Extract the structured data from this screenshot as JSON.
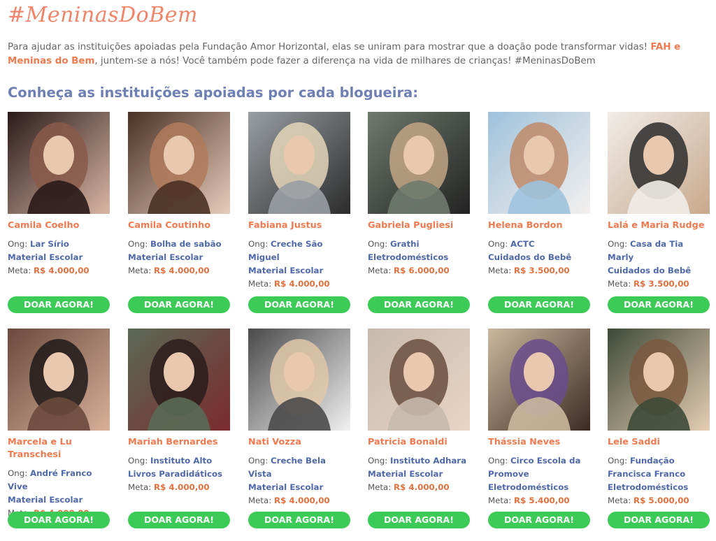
{
  "header": {
    "hashtag": "#MeninasDoBem",
    "intro_text": "Para ajudar as instituições apoiadas pela Fundação Amor Horizontal, elas se uniram para mostrar que a doação pode transformar vidas!",
    "intro_highlight": "FAH e Meninas do Bem",
    "intro_tail": ", juntem-se a nós! Você também pode fazer a diferença na vida de milhares de crianças! #MeninasDoBem",
    "section_title": "Conheça as instituições apoiadas por cada blogueira:"
  },
  "labels": {
    "ong": "Ong:",
    "meta": "Meta:",
    "button": "DOAR AGORA!"
  },
  "cards": [
    {
      "name": "Camila Coelho",
      "ong": "Lar Sírio",
      "category": "Material Escolar",
      "meta": "R$ 4.000,00",
      "colors": [
        "#2a1a1a",
        "#8a5a4a",
        "#d9b6a3"
      ]
    },
    {
      "name": "Camila Coutinho",
      "ong": "Bolha de sabão",
      "category": "Material Escolar",
      "meta": "R$ 4.000,00",
      "colors": [
        "#4a3024",
        "#b07a5c",
        "#e8cdbb"
      ]
    },
    {
      "name": "Fabiana Justus",
      "ong": "Creche São Miguel",
      "category": "Material Escolar",
      "meta": "R$ 4.000,00",
      "colors": [
        "#9a9fa3",
        "#e3d6b8",
        "#2b2b2b"
      ]
    },
    {
      "name": "Gabriela Pugliesi",
      "ong": "Grathi",
      "category": "Eletrodomésticos",
      "meta": "R$ 6.000,00",
      "colors": [
        "#6f7a6e",
        "#c2a585",
        "#222222"
      ]
    },
    {
      "name": "Helena Bordon",
      "ong": "ACTC",
      "category": "Cuidados do Bebê",
      "meta": "R$ 3.500,00",
      "colors": [
        "#9fc2dc",
        "#c08a68",
        "#f4f0ee"
      ]
    },
    {
      "name": "Lalá e Maria Rudge",
      "ong": "Casa da Tia Marly",
      "category": "Cuidados do Bebê",
      "meta": "R$ 3.500,00",
      "colors": [
        "#f0ece8",
        "#2b2b2b",
        "#c9a98c"
      ]
    },
    {
      "name": "Marcela e Lu Transchesi",
      "ong": "André Franco Vive",
      "category": "Material Escolar",
      "meta": "R$ 4.000,00",
      "colors": [
        "#6a4a3c",
        "#1f1a1a",
        "#d8b09a"
      ]
    },
    {
      "name": "Mariah Bernardes",
      "ong": "Instituto Alto Livros Paradidáticos",
      "category": "",
      "meta": "R$ 4.000,00",
      "colors": [
        "#5a6a54",
        "#2a1c1c",
        "#7b2a2e"
      ]
    },
    {
      "name": "Nati Vozza",
      "ong": "Creche Bela Vista",
      "category": "Material Escolar",
      "meta": "R$ 4.000,00",
      "colors": [
        "#4a4a4a",
        "#e0c8a8",
        "#f1f1f1"
      ]
    },
    {
      "name": "Patricia Bonaldi",
      "ong": "Instituto Adhara",
      "category": "Material Escolar",
      "meta": "R$ 4.000,00",
      "colors": [
        "#c7b9ac",
        "#6a4e3e",
        "#e9d5c6"
      ]
    },
    {
      "name": "Thássia Neves",
      "ong": "Circo Escola da Promove",
      "category": "Eletrodomésticos",
      "meta": "R$ 5.400,00",
      "colors": [
        "#cbb89d",
        "#6a4b8c",
        "#3c2a22"
      ]
    },
    {
      "name": "Lele Saddi",
      "ong": "Fundação Francisca Franco",
      "category": "Eletrodomésticos",
      "meta": "R$ 5.000,00",
      "colors": [
        "#3e4a36",
        "#7a5840",
        "#e6cdb4"
      ]
    }
  ]
}
